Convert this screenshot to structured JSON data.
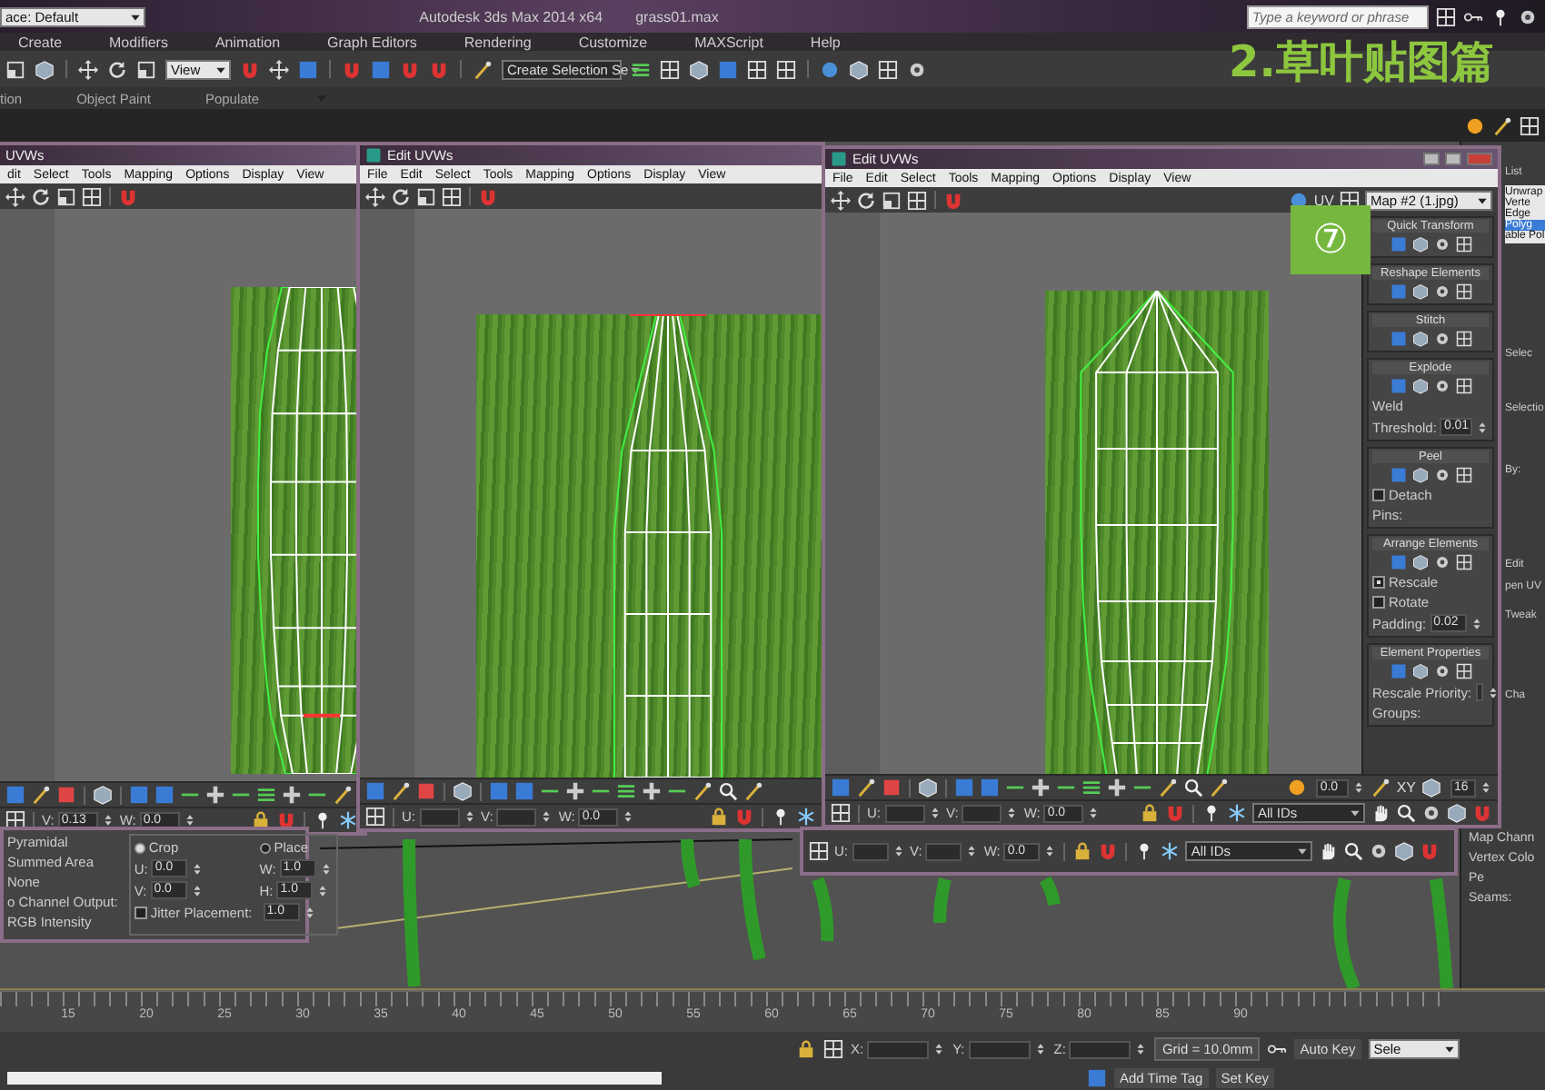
{
  "app_window": {
    "workspace": "ace: Default",
    "title": "Autodesk 3ds Max  2014 x64",
    "file": "grass01.max",
    "search": {
      "placeholder": "Type a keyword or phrase"
    }
  },
  "main_menu": [
    "Create",
    "Modifiers",
    "Animation",
    "Graph Editors",
    "Rendering",
    "Customize",
    "MAXScript",
    "Help"
  ],
  "main_toolbar": {
    "view_dropdown": "View",
    "selection_set_dropdown": "Create Selection Se"
  },
  "ribbon_tabs": [
    "tion",
    "Object Paint",
    "Populate"
  ],
  "tutorial_title": "2.草叶贴图篇",
  "step_badge": "⑦",
  "uv_windows": [
    {
      "title": "UVWs",
      "menu": [
        "dit",
        "Select",
        "Tools",
        "Mapping",
        "Options",
        "Display",
        "View"
      ],
      "fields": [
        {
          "label": "V:",
          "value": "0.13"
        },
        {
          "label": "W:",
          "value": "0.0"
        }
      ]
    },
    {
      "title": "Edit UVWs",
      "menu": [
        "File",
        "Edit",
        "Select",
        "Tools",
        "Mapping",
        "Options",
        "Display",
        "View"
      ],
      "fields": [
        {
          "label": "U:"
        },
        {
          "label": "V:"
        },
        {
          "label": "W:",
          "value": "0.0"
        }
      ]
    },
    {
      "title": "Edit UVWs",
      "menu": [
        "File",
        "Edit",
        "Select",
        "Tools",
        "Mapping",
        "Options",
        "Display",
        "View"
      ],
      "uv_label": "UV",
      "map_dropdown": "Map #2 (1.jpg)",
      "extra": {
        "value": "0.0",
        "axis": "XY",
        "number": "16"
      },
      "fields": [
        {
          "label": "U:"
        },
        {
          "label": "V:"
        },
        {
          "label": "W:",
          "value": "0.0"
        }
      ],
      "id_dropdown": "All IDs",
      "side_panel": [
        {
          "title": "Quick Transform"
        },
        {
          "title": "Reshape Elements"
        },
        {
          "title": "Stitch"
        },
        {
          "title": "Explode",
          "items": [
            {
              "kind": "label",
              "label": "Weld"
            },
            {
              "kind": "field",
              "label": "Threshold:",
              "value": "0.01"
            }
          ]
        },
        {
          "title": "Peel",
          "items": [
            {
              "kind": "check",
              "label": "Detach",
              "checked": false
            },
            {
              "kind": "label",
              "label": "Pins:"
            }
          ]
        },
        {
          "title": "Arrange Elements",
          "items": [
            {
              "kind": "check",
              "label": "Rescale",
              "checked": true
            },
            {
              "kind": "check",
              "label": "Rotate",
              "checked": false
            },
            {
              "kind": "field",
              "label": "Padding:",
              "value": "0.02"
            }
          ]
        },
        {
          "title": "Element Properties",
          "items": [
            {
              "kind": "field",
              "label": "Rescale Priority:"
            },
            {
              "kind": "label",
              "label": "Groups:"
            }
          ]
        }
      ]
    }
  ],
  "material_panel": {
    "filters": [
      "Pyramidal",
      "Summed Area",
      "None"
    ],
    "channel_heading": "o Channel Output:",
    "channel_option": "RGB Intensity",
    "modes": [
      {
        "label": "Crop",
        "selected": true
      },
      {
        "label": "Place",
        "selected": false
      }
    ],
    "fields": [
      {
        "label": "U:",
        "value": "0.0"
      },
      {
        "label": "W:",
        "value": "1.0"
      },
      {
        "label": "V:",
        "value": "0.0"
      },
      {
        "label": "H:",
        "value": "1.0"
      }
    ],
    "jitter": {
      "label": "Jitter Placement:",
      "checked": false,
      "value": "1.0"
    }
  },
  "floating_toolbar": {
    "fields": [
      {
        "label": "U:"
      },
      {
        "label": "V:"
      },
      {
        "label": "W:",
        "value": "0.0"
      }
    ],
    "id_dropdown": "All IDs"
  },
  "command_panel": {
    "heading": "List",
    "modifiers": [
      {
        "label": "Unwrap",
        "selected": false
      },
      {
        "label": "Verte",
        "selected": false
      },
      {
        "label": "Edge",
        "selected": false
      },
      {
        "label": "Polyg",
        "selected": true
      },
      {
        "label": "able Pol",
        "selected": false
      }
    ],
    "upper_labels": [
      "Selec",
      "Selectio",
      "By:",
      "Edit",
      "pen UV",
      "Tweak",
      "Cha"
    ],
    "lower_labels": [
      "Map Chann",
      "Vertex Colo",
      "Pe",
      "Seams:"
    ]
  },
  "timeline": {
    "ticks": [
      "15",
      "20",
      "25",
      "30",
      "35",
      "40",
      "45",
      "50",
      "55",
      "60",
      "65",
      "70",
      "75",
      "80",
      "85",
      "90"
    ]
  },
  "status_bar": {
    "coords": [
      "X:",
      "Y:",
      "Z:"
    ],
    "grid": "Grid = 10.0mm",
    "auto_key": "Auto Key",
    "key_filter": "Sele",
    "set_key": "Set Key",
    "add_time_tag": "Add Time Tag"
  }
}
